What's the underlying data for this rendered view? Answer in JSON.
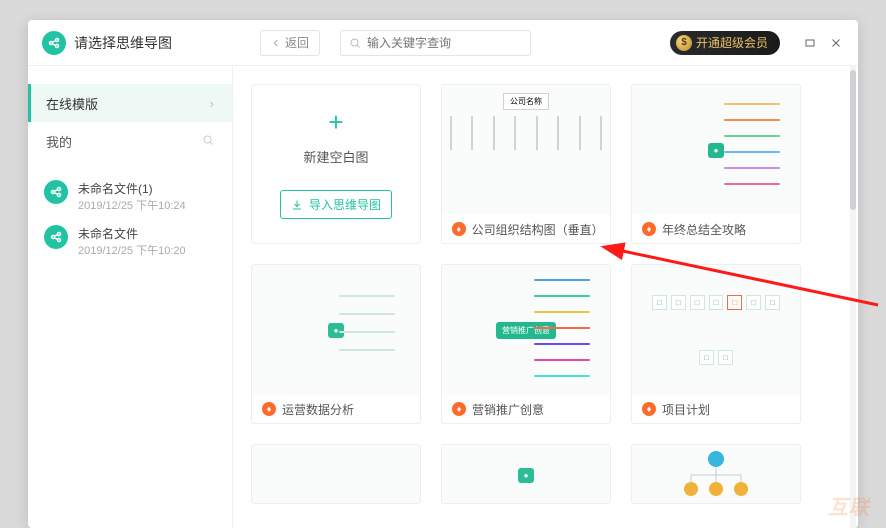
{
  "header": {
    "title": "请选择思维导图",
    "back_label": "返回",
    "search_placeholder": "输入关键字查询",
    "vip_label": "开通超级会员"
  },
  "sidebar": {
    "tab_templates": "在线模版",
    "tab_mine": "我的",
    "files": [
      {
        "name": "未命名文件(1)",
        "time": "2019/12/25 下午10:24"
      },
      {
        "name": "未命名文件",
        "time": "2019/12/25 下午10:20"
      }
    ]
  },
  "main": {
    "new_blank_label": "新建空白图",
    "import_label": "导入思维导图",
    "cards": [
      {
        "title": "公司组织结构图（垂直）",
        "root": "公司名称"
      },
      {
        "title": "年终总结全攻略"
      },
      {
        "title": "运营数据分析"
      },
      {
        "title": "营销推广创意",
        "core": "营销推广创意"
      },
      {
        "title": "项目计划"
      }
    ]
  }
}
